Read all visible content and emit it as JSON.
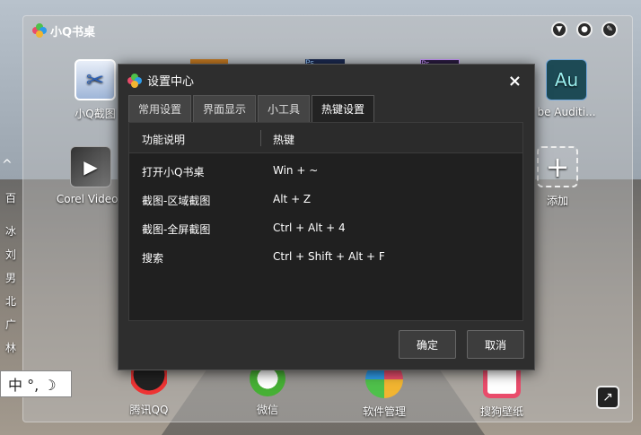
{
  "desktop": {
    "title": "小Q书桌",
    "apps_row1": [
      {
        "label": "小Q截图",
        "icon": "scissors-icon"
      },
      {
        "label": "be Auditi...",
        "icon": "audition-icon"
      }
    ],
    "apps_row2": [
      {
        "label": "Corel VideoS",
        "icon": "video-icon"
      },
      {
        "label": "添加",
        "icon": "add-icon"
      }
    ],
    "apps_bottom": [
      {
        "label": "腾讯QQ",
        "icon": "qq-icon"
      },
      {
        "label": "微信",
        "icon": "wechat-icon"
      },
      {
        "label": "软件管理",
        "icon": "software-icon"
      },
      {
        "label": "搜狗壁纸",
        "icon": "wallpaper-icon"
      }
    ],
    "icon_texts": {
      "au": "Au",
      "ps": "Ps",
      "pr": "Pr"
    },
    "sidebar": [
      "百",
      "冰",
      "刘",
      "男",
      "北",
      "广",
      "林"
    ]
  },
  "ime": {
    "text": "中 °, ☽"
  },
  "dialog": {
    "title": "设置中心",
    "close": "×",
    "tabs": [
      "常用设置",
      "界面显示",
      "小工具",
      "热键设置"
    ],
    "active_tab": 3,
    "columns": [
      "功能说明",
      "热键"
    ],
    "rows": [
      {
        "func": "打开小Q书桌",
        "key": "Win + ~"
      },
      {
        "func": "截图-区域截图",
        "key": "Alt + Z"
      },
      {
        "func": "截图-全屏截图",
        "key": "Ctrl + Alt + 4"
      },
      {
        "func": "搜索",
        "key": "Ctrl + Shift + Alt + F"
      }
    ],
    "ok": "确定",
    "cancel": "取消"
  },
  "colors": {
    "accent": "#f2b531",
    "dialog_bg": "#2e2e2e"
  }
}
